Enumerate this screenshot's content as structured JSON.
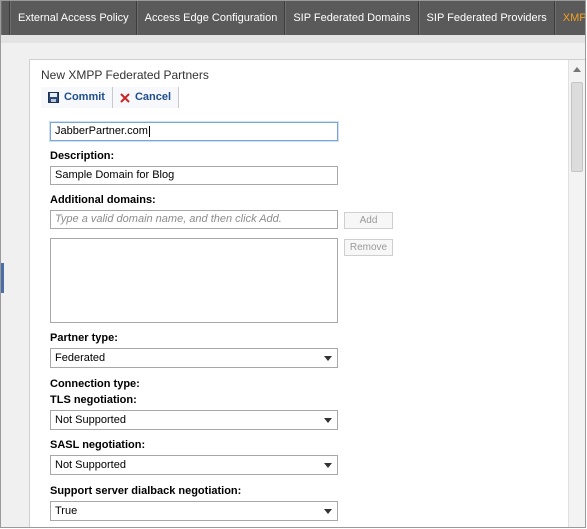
{
  "tabs": [
    {
      "label": ""
    },
    {
      "label": "External Access Policy"
    },
    {
      "label": "Access Edge Configuration"
    },
    {
      "label": "SIP Federated Domains"
    },
    {
      "label": "SIP Federated Providers"
    },
    {
      "label": "XMPP Federated Partners",
      "active": true
    }
  ],
  "dialog": {
    "title": "New XMPP Federated Partners",
    "toolbar": {
      "commit_label": "Commit",
      "cancel_label": "Cancel"
    },
    "domain_value": "JabberPartner.com",
    "description_label": "Description:",
    "description_value": "Sample Domain for Blog",
    "additional_domains_label": "Additional domains:",
    "additional_domains_placeholder": "Type a valid domain name, and then click Add.",
    "add_label": "Add",
    "remove_label": "Remove",
    "partner_type_label": "Partner type:",
    "partner_type_value": "Federated",
    "connection_type_label": "Connection type:",
    "tls_label": "TLS negotiation:",
    "tls_value": "Not Supported",
    "sasl_label": "SASL negotiation:",
    "sasl_value": "Not Supported",
    "dialback_label": "Support server dialback negotiation:",
    "dialback_value": "True"
  },
  "colors": {
    "tab_bar": "#5a5a5a",
    "active_tab_text": "#f4a020",
    "toolbar_text": "#1f4e8c",
    "cancel_icon": "#d02020"
  }
}
